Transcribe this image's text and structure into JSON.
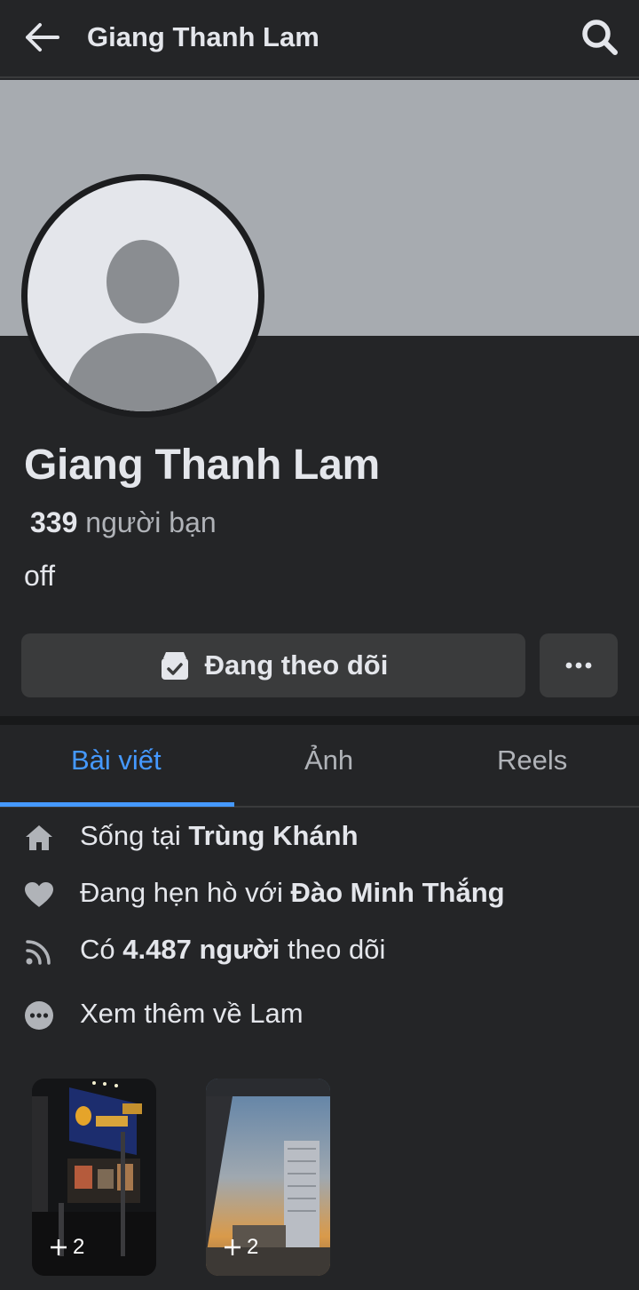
{
  "header": {
    "title": "Giang Thanh Lam"
  },
  "profile": {
    "name": "Giang Thanh Lam",
    "friends_count": "339",
    "friends_label": "người bạn",
    "bio": "off"
  },
  "actions": {
    "follow_label": "Đang theo dõi"
  },
  "tabs": [
    {
      "label": "Bài viết",
      "active": true
    },
    {
      "label": "Ảnh",
      "active": false
    },
    {
      "label": "Reels",
      "active": false
    }
  ],
  "details": {
    "lives_prefix": "Sống tại ",
    "lives_place": "Trùng Khánh",
    "relationship_prefix": "Đang hẹn hò với ",
    "relationship_partner": "Đào Minh Thắng",
    "followers_prefix": "Có ",
    "followers_count": "4.487 người",
    "followers_suffix": " theo dõi",
    "see_more": "Xem thêm về Lam"
  },
  "stories": [
    {
      "count": "2"
    },
    {
      "count": "2"
    }
  ],
  "colors": {
    "background": "#242527",
    "accent": "#4599ff",
    "button": "#3a3b3c",
    "cover": "#a7abb0"
  }
}
